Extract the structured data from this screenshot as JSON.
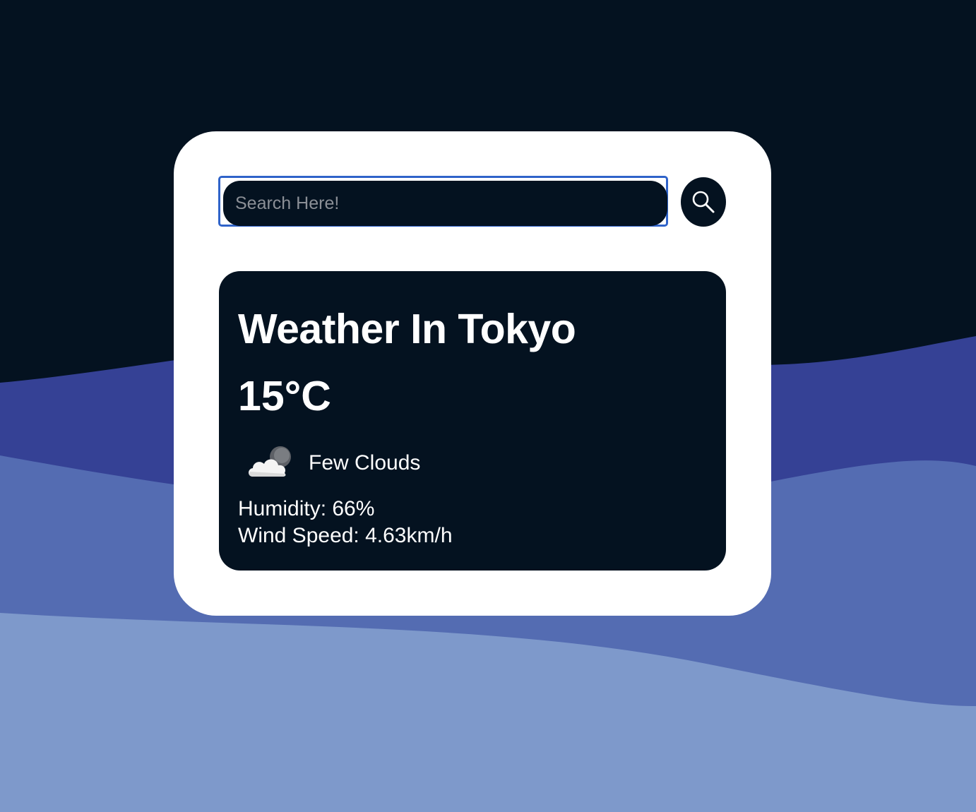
{
  "search": {
    "placeholder": "Search Here!",
    "value": "",
    "button_icon": "search-icon"
  },
  "weather": {
    "title": "Weather In Tokyo",
    "temperature": "15°C",
    "condition_icon": "few-clouds-icon",
    "condition": "Few Clouds",
    "humidity": "Humidity: 66%",
    "wind": "Wind Speed: 4.63km/h"
  },
  "colors": {
    "background_dark": "#041220",
    "wave_1": "#354195",
    "wave_2": "#546cb2",
    "wave_3": "#7e99cb",
    "card": "#ffffff",
    "focus_ring": "#2f63c9"
  }
}
